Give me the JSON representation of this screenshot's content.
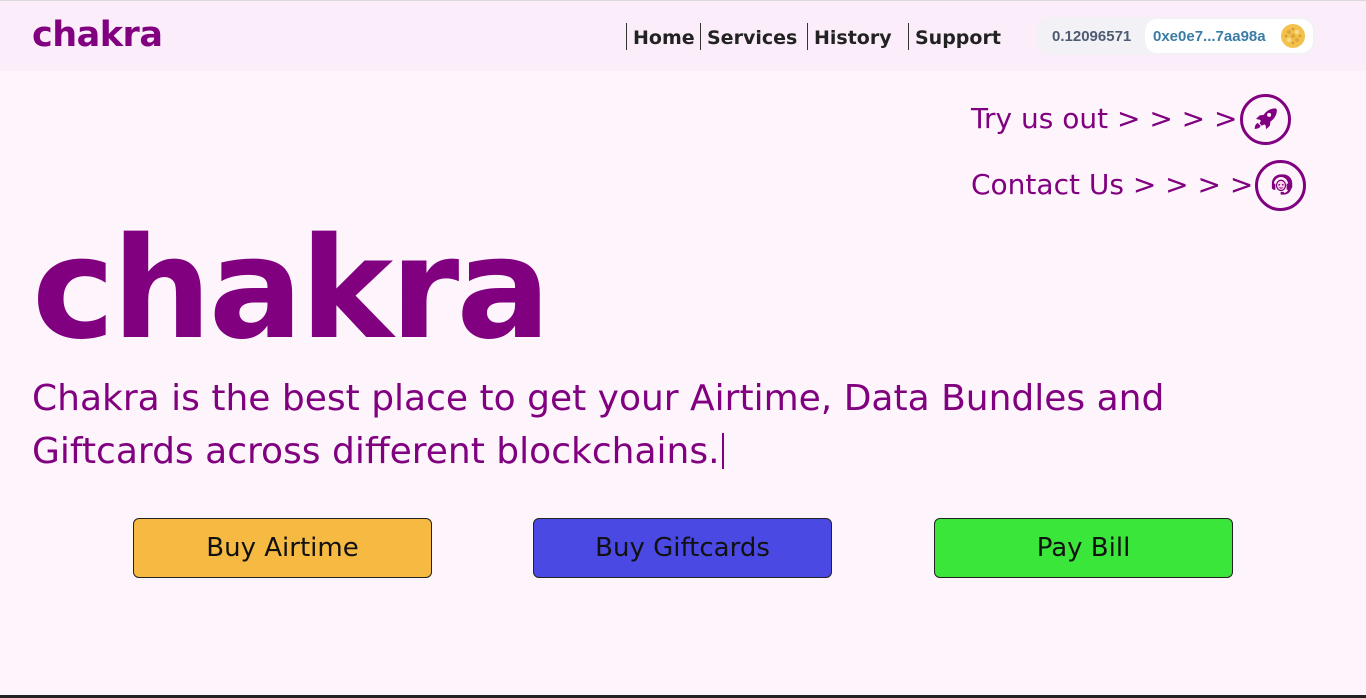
{
  "navbar": {
    "brand": "chakra",
    "links": [
      {
        "label": "Home"
      },
      {
        "label": "Services"
      },
      {
        "label": "History"
      },
      {
        "label": "Support"
      }
    ],
    "wallet": {
      "balance": "0.12096571",
      "address": "0xe0e7...7aa98a",
      "avatar_icon": "wallet-identicon"
    }
  },
  "cta": {
    "try": {
      "label": "Try us out > > > >",
      "icon": "rocket-icon"
    },
    "contact": {
      "label": "Contact Us > > > >",
      "icon": "support-agent-icon"
    }
  },
  "hero": {
    "title": "chakra",
    "description": "Chakra is the best place to get your Airtime, Data Bundles and Giftcards across different blockchains."
  },
  "actions": {
    "airtime": {
      "label": "Buy Airtime",
      "color": "#f6b942"
    },
    "giftcards": {
      "label": "Buy Giftcards",
      "color": "#4b49e3"
    },
    "bill": {
      "label": "Pay Bill",
      "color": "#3be63a"
    }
  },
  "colors": {
    "brand": "#800080",
    "background": "#fdf5fb",
    "navbar": "#fbeefa"
  }
}
